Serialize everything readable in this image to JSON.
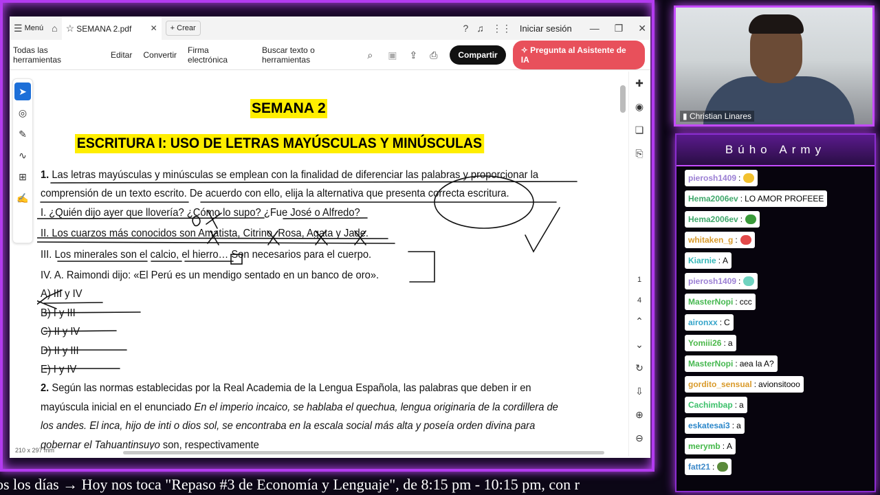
{
  "app": {
    "menu_label": "Menú",
    "tab_title": "SEMANA 2.pdf",
    "new_tab_label": "Crear",
    "signin_label": "Iniciar sesión"
  },
  "toolbar": {
    "all_tools": "Todas las herramientas",
    "edit": "Editar",
    "convert": "Convertir",
    "esign": "Firma electrónica",
    "search_label": "Buscar texto o herramientas",
    "share_label": "Compartir",
    "ai_label": "Pregunta al Asistente de IA"
  },
  "page_nav": {
    "current": "1",
    "total": "4"
  },
  "doc_size": "210 x 297 mm",
  "document": {
    "week_title": "SEMANA 2",
    "main_title": "ESCRITURA I: USO DE LETRAS MAYÚSCULAS Y MINÚSCULAS",
    "q1_num": "1.",
    "q1_line1": "Las letras mayúsculas y minúsculas se emplean con la finalidad de diferenciar las palabras y proporcionar la",
    "q1_line2": "comprensión de un texto escrito. De acuerdo con ello, elija la alternativa que presenta correcta escritura.",
    "q1_i": "I. ¿Quién dijo ayer que llovería? ¿Cómo lo supo? ¿Fue José o Alfredo?",
    "q1_ii": "II. Los cuarzos más conocidos son Amatista, Citrino, Rosa, Agata y Jade.",
    "q1_iii": "III. Los minerales son el calcio, el hierro… Son necesarios para el cuerpo.",
    "q1_iv": "IV. A. Raimondi dijo: «El Perú es un mendigo sentado en un banco de oro».",
    "options": [
      "A) III y IV",
      "B) I y III",
      "C) II y IV",
      "D) II y III",
      "E) I y IV"
    ],
    "q2_num": "2.",
    "q2_line1": "Según las normas establecidas por la Real Academia de la Lengua Española, las palabras que deben ir en",
    "q2_line2a": "mayúscula inicial en el enunciado",
    "q2_line2b": "En el imperio incaico, se hablaba el quechua, lengua originaria de la cordillera de",
    "q2_line3": "los andes. El inca, hijo de inti o dios sol, se encontraba en la escala social más alta y poseía orden divina para",
    "q2_line4a": "gobernar el Tahuantinsuyo",
    "q2_line4b": "son, respectivamente"
  },
  "ticker": "os los días → Hoy nos toca \"Repaso #3 de Economía y Lenguaje\", de 8:15 pm - 10:15 pm, con r",
  "webcam": {
    "name": "Christian Linares"
  },
  "chat": {
    "title": "Búho Army",
    "messages": [
      {
        "user": "pierosh1409",
        "text": "",
        "user_color": "#9b7fd4",
        "emote": "#f2c12e"
      },
      {
        "user": "Hema2006ev",
        "text": "LO AMOR PROFEEE",
        "user_color": "#3fa86b",
        "emote": ""
      },
      {
        "user": "Hema2006ev",
        "text": "",
        "user_color": "#3fa86b",
        "emote": "#3a9a3a"
      },
      {
        "user": "whitaken_g",
        "text": "",
        "user_color": "#d89a2a",
        "emote": "#e24a4a"
      },
      {
        "user": "Kiarnie",
        "text": "A",
        "user_color": "#35b7b7",
        "emote": ""
      },
      {
        "user": "pierosh1409",
        "text": "",
        "user_color": "#9b7fd4",
        "emote": "#6fd3c0"
      },
      {
        "user": "MasterNopi",
        "text": "ccc",
        "user_color": "#46b850",
        "emote": ""
      },
      {
        "user": "aironxx",
        "text": "C",
        "user_color": "#34a4c9",
        "emote": ""
      },
      {
        "user": "Yomiii26",
        "text": "a",
        "user_color": "#4bb84a",
        "emote": ""
      },
      {
        "user": "MasterNopi",
        "text": "aea la A?",
        "user_color": "#46b850",
        "emote": ""
      },
      {
        "user": "gordito_sensual",
        "text": "avionsitooo",
        "user_color": "#d99a2a",
        "emote": ""
      },
      {
        "user": "Cachimbap",
        "text": "a",
        "user_color": "#3cc06a",
        "emote": ""
      },
      {
        "user": "eskatesai3",
        "text": "a",
        "user_color": "#2a86c9",
        "emote": ""
      },
      {
        "user": "merymb",
        "text": "A",
        "user_color": "#45b84a",
        "emote": ""
      },
      {
        "user": "fatt21",
        "text": "",
        "user_color": "#3d89c9",
        "emote": "#5a8a3a"
      }
    ]
  },
  "colors": {
    "accent": "#c54cff",
    "highlight": "#ffee00",
    "share": "#111111",
    "ai": "#e8505b",
    "select_tool": "#1d6fd8"
  }
}
